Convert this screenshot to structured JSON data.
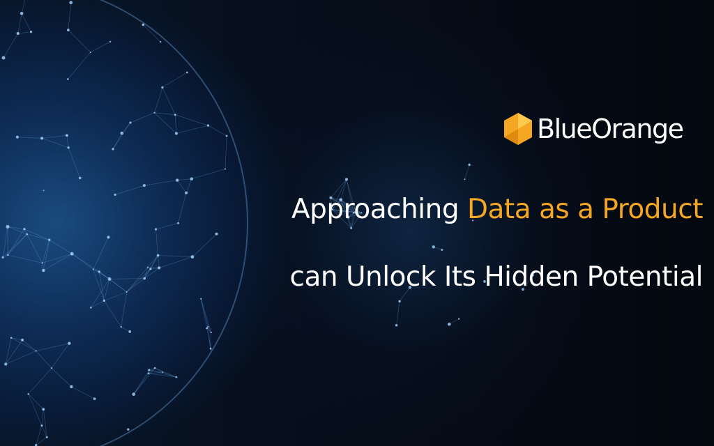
{
  "brand": {
    "name": "BlueOrange",
    "logo_color": "#f5a623"
  },
  "headline": {
    "line1_prefix": "Approaching ",
    "line1_highlight": "Data as a Product",
    "line2": "can Unlock Its Hidden Potential",
    "highlight_color": "#f5a623"
  },
  "decor_icons": [
    "shopping-cart-icon",
    "location-pin-icon",
    "music-note-icon",
    "shield-icon",
    "document-icon"
  ]
}
